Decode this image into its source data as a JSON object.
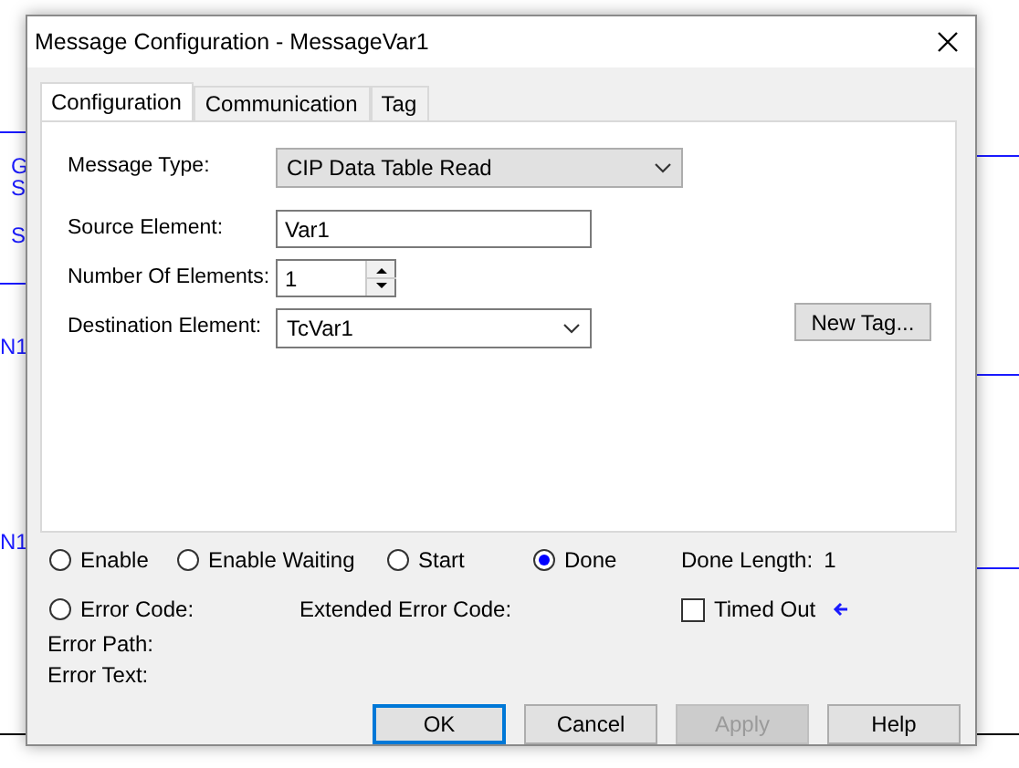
{
  "background_labels": [
    "G",
    "S",
    "S",
    "N1",
    "N1"
  ],
  "window": {
    "title": "Message Configuration - MessageVar1"
  },
  "tabs": [
    {
      "label": "Configuration",
      "selected": true
    },
    {
      "label": "Communication",
      "selected": false
    },
    {
      "label": "Tag",
      "selected": false
    }
  ],
  "configuration": {
    "message_type": {
      "label": "Message Type:",
      "value": "CIP Data Table Read"
    },
    "source_element": {
      "label": "Source Element:",
      "value": "Var1"
    },
    "number_of_elements": {
      "label": "Number Of Elements:",
      "value": "1"
    },
    "destination_element": {
      "label": "Destination Element:",
      "value": "TcVar1"
    },
    "new_tag_button": "New Tag..."
  },
  "status": {
    "radios": [
      {
        "label": "Enable",
        "selected": false
      },
      {
        "label": "Enable Waiting",
        "selected": false
      },
      {
        "label": "Start",
        "selected": false
      },
      {
        "label": "Done",
        "selected": true
      }
    ],
    "done_length": {
      "label": "Done Length:",
      "value": "1"
    },
    "error_code": {
      "label": "Error Code:",
      "selected": false
    },
    "extended_error_code": {
      "label": "Extended Error Code:"
    },
    "timed_out": {
      "label": "Timed Out",
      "checked": false
    },
    "error_path": {
      "label": "Error Path:"
    },
    "error_text": {
      "label": "Error Text:"
    }
  },
  "buttons": [
    {
      "label": "OK",
      "default": true,
      "disabled": false
    },
    {
      "label": "Cancel",
      "default": false,
      "disabled": false
    },
    {
      "label": "Apply",
      "default": false,
      "disabled": true
    },
    {
      "label": "Help",
      "default": false,
      "disabled": false
    }
  ]
}
